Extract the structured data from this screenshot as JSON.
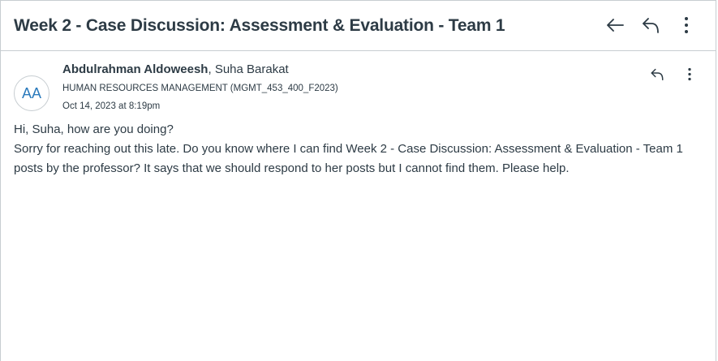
{
  "conversation": {
    "subject": "Week 2 - Case Discussion: Assessment & Evaluation - Team 1"
  },
  "header_actions": {
    "back_icon": "arrow-left-icon",
    "reply_icon": "reply-icon",
    "more_icon": "more-vertical-icon"
  },
  "message": {
    "avatar_initials": "AA",
    "author": "Abdulrahman Aldoweesh",
    "separator": ", ",
    "recipient": "Suha Barakat",
    "course": "HUMAN RESOURCES MANAGEMENT (MGMT_453_400_F2023)",
    "date": "Oct 14, 2023 at 8:19pm",
    "body_line_1": "Hi, Suha, how are you doing?",
    "body_line_2": "Sorry for reaching out this late. Do you know where I can find Week 2 - Case Discussion: Assessment & Evaluation - Team 1 posts by the professor? It says that we should respond to her posts but I cannot find them. Please help."
  },
  "colors": {
    "text": "#2d3b45",
    "avatar_text": "#2b7abc",
    "border": "#c7cdd1"
  }
}
